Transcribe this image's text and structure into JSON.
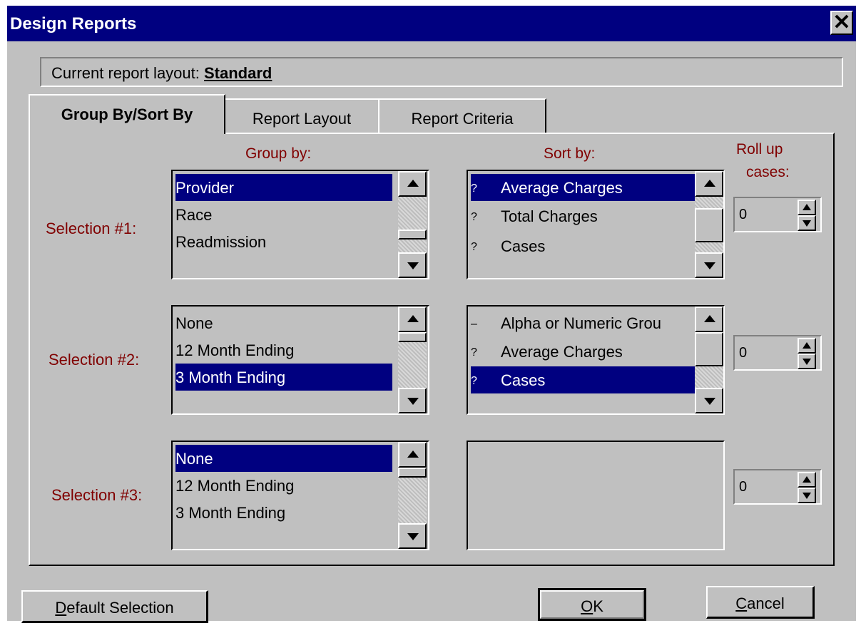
{
  "window": {
    "title": "Design Reports",
    "close_label": "✕"
  },
  "layout": {
    "label": "Current report layout:",
    "value": "Standard"
  },
  "tabs": [
    {
      "label": "Group By/Sort By",
      "active": true
    },
    {
      "label": "Report Layout",
      "active": false
    },
    {
      "label": "Report Criteria",
      "active": false
    }
  ],
  "headers": {
    "group_by": "Group by:",
    "sort_by": "Sort by:",
    "roll_up_line1": "Roll up",
    "roll_up_line2": "cases:"
  },
  "selections": [
    {
      "label": "Selection #1:",
      "group_items": [
        "Provider",
        "Race",
        "Readmission"
      ],
      "group_selected": 0,
      "sort_items": [
        {
          "mark": "?",
          "text": "Average Charges"
        },
        {
          "mark": "?",
          "text": "Total Charges"
        },
        {
          "mark": "?",
          "text": "Cases"
        }
      ],
      "sort_selected": 0,
      "roll_up": "0"
    },
    {
      "label": "Selection #2:",
      "group_items": [
        "None",
        "12 Month Ending",
        "3 Month Ending"
      ],
      "group_selected": 2,
      "sort_items": [
        {
          "mark": "–",
          "text": "Alpha or Numeric Grou"
        },
        {
          "mark": "?",
          "text": "Average Charges"
        },
        {
          "mark": "?",
          "text": "Cases"
        }
      ],
      "sort_selected": 2,
      "roll_up": "0"
    },
    {
      "label": "Selection #3:",
      "group_items": [
        "None",
        "12 Month Ending",
        "3 Month Ending"
      ],
      "group_selected": 0,
      "sort_items": [],
      "roll_up": "0"
    }
  ],
  "buttons": {
    "default_selection": "Default Selection",
    "ok": "OK",
    "cancel": "Cancel"
  },
  "colors": {
    "titlebar": "#000080",
    "selection": "#000080",
    "label": "#800000",
    "face": "#c0c0c0"
  }
}
